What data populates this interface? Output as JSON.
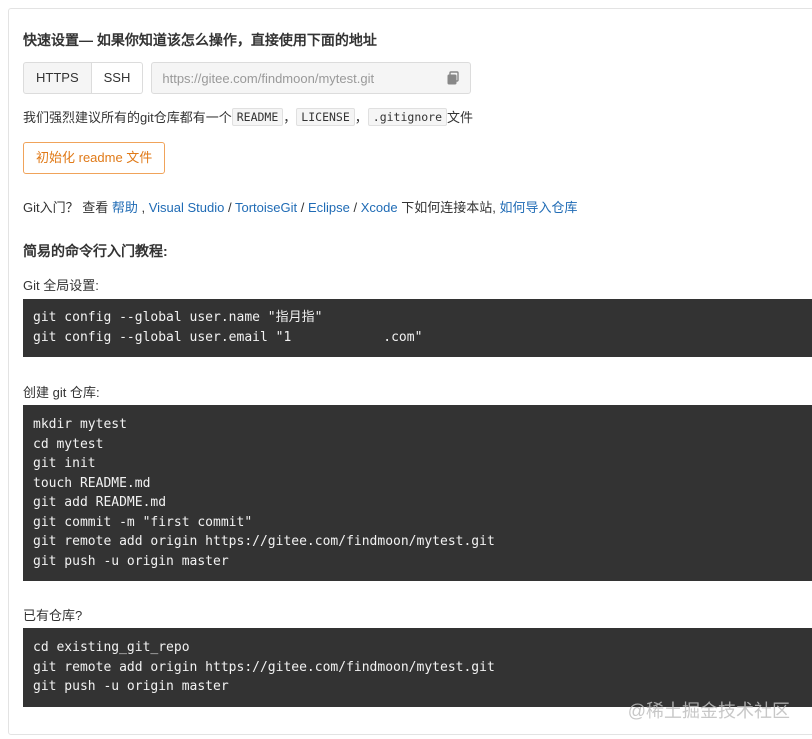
{
  "quick_setup": {
    "heading": "快速设置— 如果你知道该怎么操作，直接使用下面的地址",
    "protocols": [
      "HTTPS",
      "SSH"
    ],
    "repo_url": "https://gitee.com/findmoon/mytest.git",
    "copy_icon": "copy-icon"
  },
  "suggestion": {
    "prefix": "我们强烈建议所有的git仓库都有一个",
    "files": [
      "README",
      "LICENSE",
      ".gitignore"
    ],
    "sep": "，",
    "suffix": "文件"
  },
  "init_button": "初始化 readme 文件",
  "help": {
    "prefix": "Git入门？ 查看 ",
    "links": [
      "帮助",
      "Visual Studio",
      "TortoiseGit",
      "Eclipse",
      "Xcode"
    ],
    "link_sep_1": " , ",
    "link_sep": " / ",
    "middle": " 下如何连接本站, ",
    "import_link": "如何导入仓库"
  },
  "tutorial": {
    "title": "简易的命令行入门教程:",
    "global_label": "Git 全局设置:",
    "global_lines": [
      "git config --global user.name \"指月指\"",
      "git config --global user.email \"1"
    ],
    "email_suffix": ".com\"",
    "create_label": "创建 git 仓库:",
    "create_lines": [
      "mkdir mytest",
      "cd mytest",
      "git init",
      "touch README.md",
      "git add README.md",
      "git commit -m \"first commit\"",
      "git remote add origin https://gitee.com/findmoon/mytest.git",
      "git push -u origin master"
    ],
    "existing_label": "已有仓库?",
    "existing_lines": [
      "cd existing_git_repo",
      "git remote add origin https://gitee.com/findmoon/mytest.git",
      "git push -u origin master"
    ]
  },
  "watermark": "@稀土掘金技术社区",
  "colors": {
    "link": "#1f6bb5",
    "init_button": "#e07a18",
    "code_bg": "#333333"
  }
}
